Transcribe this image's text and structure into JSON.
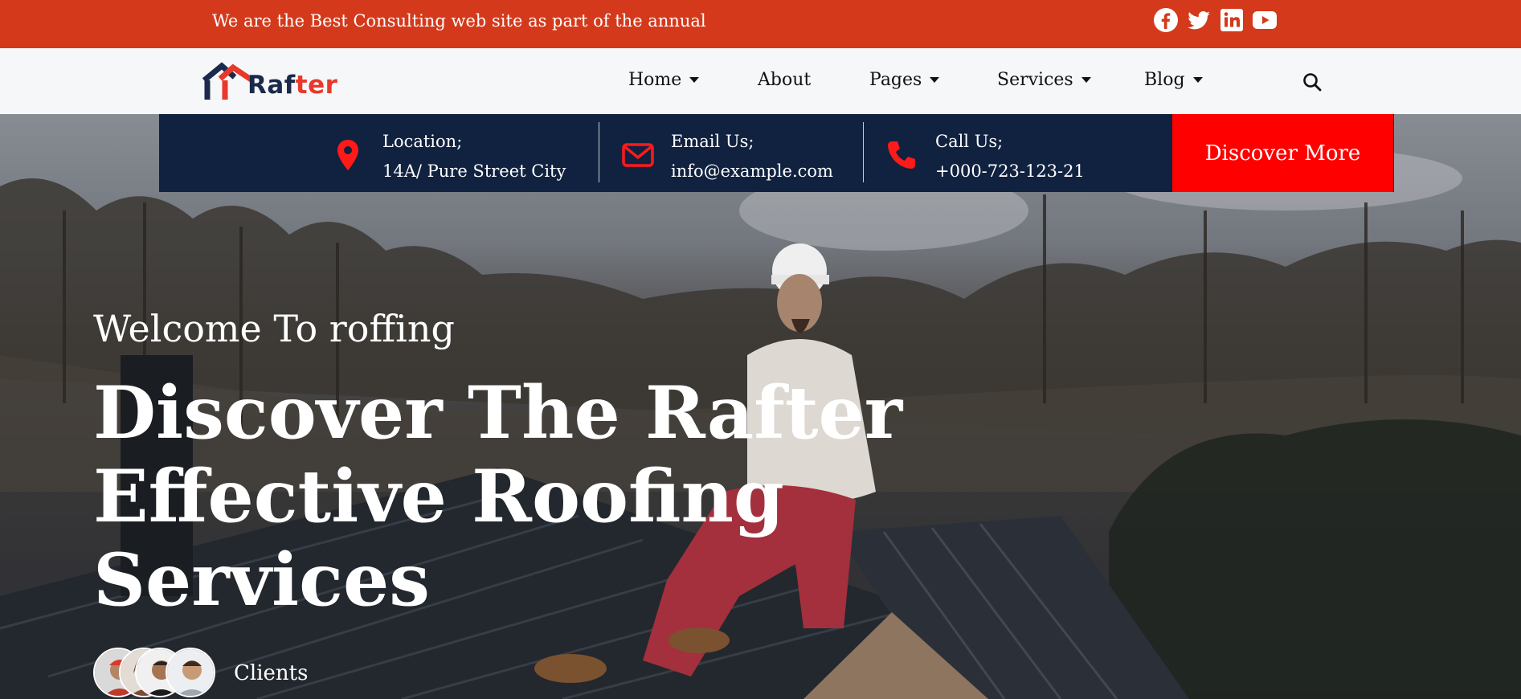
{
  "topbar": {
    "tagline": "We are the Best Consulting web site as part of the annual",
    "socials": [
      "facebook-icon",
      "twitter-icon",
      "linkedin-icon",
      "youtube-icon"
    ],
    "bg_color": "#d4391b"
  },
  "nav": {
    "logo_text_main": "Raf",
    "logo_text_accent": "ter",
    "items": [
      {
        "label": "Home",
        "dropdown": true
      },
      {
        "label": "About",
        "dropdown": false
      },
      {
        "label": "Pages",
        "dropdown": true
      },
      {
        "label": "Services",
        "dropdown": true
      },
      {
        "label": "Blog",
        "dropdown": true
      }
    ],
    "search_icon": "search-icon"
  },
  "contact": {
    "location_title": "Location;",
    "location_value": "14A/ Pure Street City",
    "email_title": "Email Us;",
    "email_value": "info@example.com",
    "call_title": "Call Us;",
    "call_value": "+000-723-123-21",
    "cta_label": "Discover More",
    "bg_color": "#112240",
    "accent_color": "#ff0000"
  },
  "hero": {
    "welcome": "Welcome To roffing",
    "headline_line1": "Discover The Rafter",
    "headline_line2": "Effective Roofing",
    "headline_line3": "Services",
    "clients_label": "Clients"
  }
}
